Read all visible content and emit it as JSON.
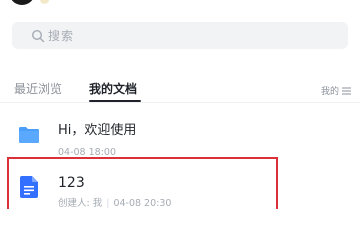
{
  "search": {
    "placeholder": "搜索"
  },
  "tabs": [
    {
      "label": "最近浏览",
      "active": false
    },
    {
      "label": "我的文档",
      "active": true
    }
  ],
  "filter": {
    "label": "我的"
  },
  "items": [
    {
      "type": "folder",
      "title": "Hi，欢迎使用",
      "date": "04-08 18:00"
    },
    {
      "type": "document",
      "title": "123",
      "creator": "创建人: 我",
      "date": "04-08 20:30"
    }
  ],
  "colors": {
    "folder": "#4a9df8",
    "document": "#3370ff",
    "highlight": "#d9303a",
    "search_bg": "#f2f3f5"
  }
}
